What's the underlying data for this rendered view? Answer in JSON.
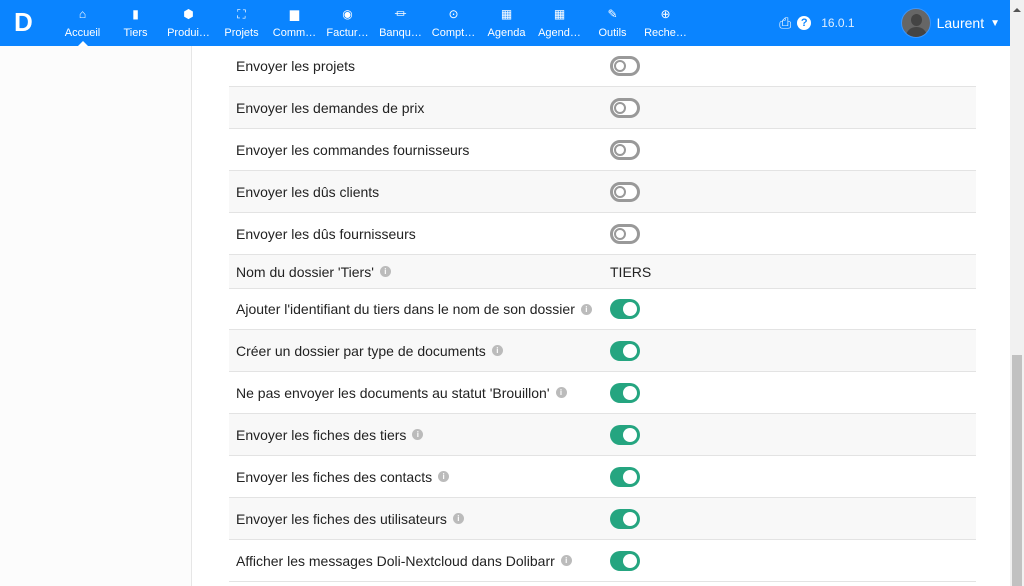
{
  "topbar": {
    "logo": "D",
    "menu": [
      {
        "icon": "home-icon",
        "glyph": "⌂",
        "label": "Accueil"
      },
      {
        "icon": "building-icon",
        "glyph": "▮",
        "label": "Tiers"
      },
      {
        "icon": "cube-icon",
        "glyph": "⬢",
        "label": "Produi…"
      },
      {
        "icon": "project-icon",
        "glyph": "⛶",
        "label": "Projets"
      },
      {
        "icon": "briefcase-icon",
        "glyph": "▆",
        "label": "Comm…"
      },
      {
        "icon": "coins-icon",
        "glyph": "◉",
        "label": "Factur…"
      },
      {
        "icon": "bank-icon",
        "glyph": "⏛",
        "label": "Banqu…"
      },
      {
        "icon": "search-dollar-icon",
        "glyph": "⊙",
        "label": "Compt…"
      },
      {
        "icon": "calendar-icon",
        "glyph": "▦",
        "label": "Agenda"
      },
      {
        "icon": "calendar-icon",
        "glyph": "▦",
        "label": "Agend…"
      },
      {
        "icon": "wrench-icon",
        "glyph": "✎",
        "label": "Outils"
      },
      {
        "icon": "search-plus-icon",
        "glyph": "⊕",
        "label": "Reche…"
      }
    ],
    "version": "16.0.1",
    "user": "Laurent"
  },
  "rows": [
    {
      "label": "Envoyer les projets",
      "type": "toggle",
      "on": false,
      "info": false
    },
    {
      "label": "Envoyer les demandes de prix",
      "type": "toggle",
      "on": false,
      "info": false
    },
    {
      "label": "Envoyer les commandes fournisseurs",
      "type": "toggle",
      "on": false,
      "info": false
    },
    {
      "label": "Envoyer les dûs clients",
      "type": "toggle",
      "on": false,
      "info": false
    },
    {
      "label": "Envoyer les dûs fournisseurs",
      "type": "toggle",
      "on": false,
      "info": false
    },
    {
      "label": "Nom du dossier 'Tiers'",
      "type": "text",
      "value": "TIERS",
      "info": true
    },
    {
      "label": "Ajouter l'identifiant du tiers dans le nom de son dossier",
      "type": "toggle",
      "on": true,
      "info": true
    },
    {
      "label": "Créer un dossier par type de documents",
      "type": "toggle",
      "on": true,
      "info": true
    },
    {
      "label": "Ne pas envoyer les documents au statut 'Brouillon'",
      "type": "toggle",
      "on": true,
      "info": true
    },
    {
      "label": "Envoyer les fiches des tiers",
      "type": "toggle",
      "on": true,
      "info": true
    },
    {
      "label": "Envoyer les fiches des contacts",
      "type": "toggle",
      "on": true,
      "info": true
    },
    {
      "label": "Envoyer les fiches des utilisateurs",
      "type": "toggle",
      "on": true,
      "info": true
    },
    {
      "label": "Afficher les messages Doli-Nextcloud dans Dolibarr",
      "type": "toggle",
      "on": true,
      "info": true
    }
  ]
}
